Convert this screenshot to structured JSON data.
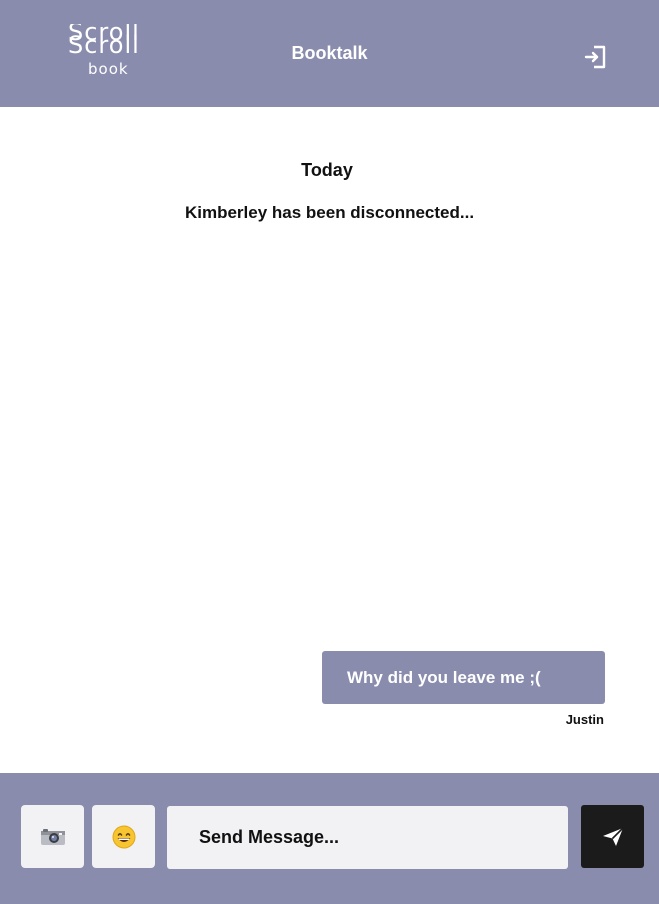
{
  "header": {
    "logo": {
      "line1": "Scroll",
      "line2": "Scroll",
      "line3": "book"
    },
    "title": "Booktalk",
    "logout_icon": "logout-door-icon"
  },
  "chat": {
    "day_label": "Today",
    "system_message": "Kimberley has been disconnected...",
    "messages": [
      {
        "text": "Why did you leave me ;(",
        "sender": "Justin"
      }
    ]
  },
  "composer": {
    "camera_icon": "camera-icon",
    "emoji_icon": "grinning-face-icon",
    "input_placeholder": "Send Message...",
    "input_value": "",
    "send_icon": "paper-plane-icon"
  },
  "colors": {
    "brand": "#8a8cae",
    "send_button": "#1b1b1b",
    "input_background": "#f2f2f4"
  }
}
